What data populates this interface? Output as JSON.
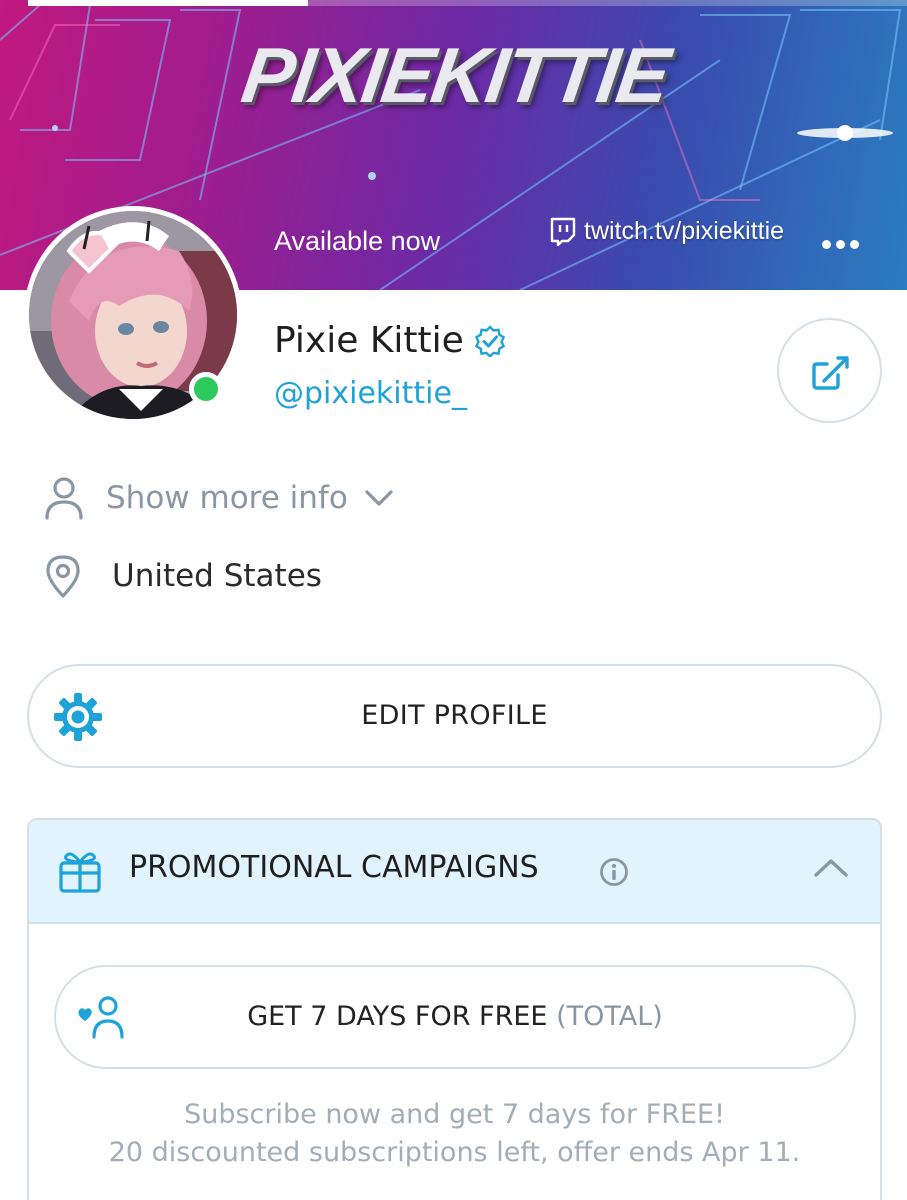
{
  "banner": {
    "logo_text": "PIXIEKITTIE",
    "status_text": "Available now",
    "twitch_link": "twitch.tv/pixiekittie",
    "twitch_icon": "twitch-icon",
    "menu_icon": "more-dots-icon"
  },
  "profile": {
    "display_name": "Pixie Kittie",
    "verified_icon": "verified-check-icon",
    "username": "@pixiekittie_",
    "online": true,
    "share_icon": "share-icon"
  },
  "info": {
    "show_more_label": "Show more info",
    "location": "United States"
  },
  "actions": {
    "edit_profile_label": "EDIT PROFILE"
  },
  "promo": {
    "title": "PROMOTIONAL CAMPAIGNS",
    "trial_label": "GET 7 DAYS FOR FREE",
    "trial_suffix": "(TOTAL)",
    "desc_line1": "Subscribe now and get 7 days for FREE!",
    "desc_line2": "20 discounted subscriptions left, offer ends Apr 11."
  },
  "colors": {
    "accent": "#1ea3d8",
    "online": "#2ec95c",
    "promo_header_bg": "#e1f3fc",
    "muted_text": "#8a96a3"
  }
}
